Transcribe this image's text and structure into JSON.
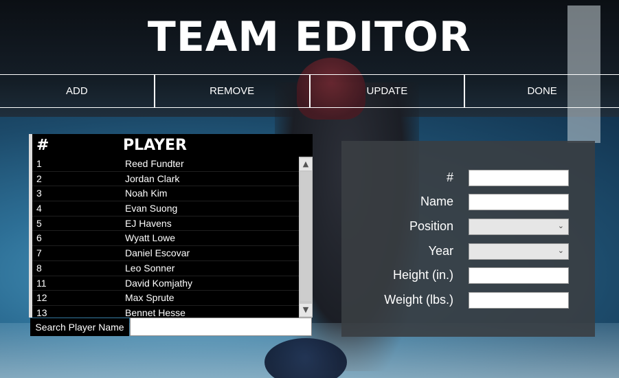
{
  "app": {
    "title": "TEAM EDITOR"
  },
  "toolbar": {
    "add_label": "ADD",
    "remove_label": "REMOVE",
    "update_label": "UPDATE",
    "done_label": "DONE"
  },
  "player_list": {
    "headers": {
      "number": "#",
      "player": "PLAYER"
    },
    "rows": [
      {
        "number": "1",
        "name": "Reed Fundter"
      },
      {
        "number": "2",
        "name": "Jordan Clark"
      },
      {
        "number": "3",
        "name": "Noah Kim"
      },
      {
        "number": "4",
        "name": "Evan Suong"
      },
      {
        "number": "5",
        "name": "EJ Havens"
      },
      {
        "number": "6",
        "name": "Wyatt Lowe"
      },
      {
        "number": "7",
        "name": "Daniel Escovar"
      },
      {
        "number": "8",
        "name": "Leo Sonner"
      },
      {
        "number": "11",
        "name": "David Komjathy"
      },
      {
        "number": "12",
        "name": "Max Sprute"
      },
      {
        "number": "13",
        "name": "Bennet Hesse"
      }
    ]
  },
  "search": {
    "label": "Search Player Name",
    "value": ""
  },
  "detail_form": {
    "number_label": "#",
    "name_label": "Name",
    "position_label": "Position",
    "year_label": "Year",
    "height_label": "Height (in.)",
    "weight_label": "Weight (lbs.)",
    "number_value": "",
    "name_value": "",
    "position_value": "",
    "year_value": "",
    "height_value": "",
    "weight_value": ""
  },
  "icons": {
    "scroll_up": "chevron-up-icon",
    "scroll_down": "chevron-down-icon",
    "select_arrow": "chevron-down-icon"
  }
}
